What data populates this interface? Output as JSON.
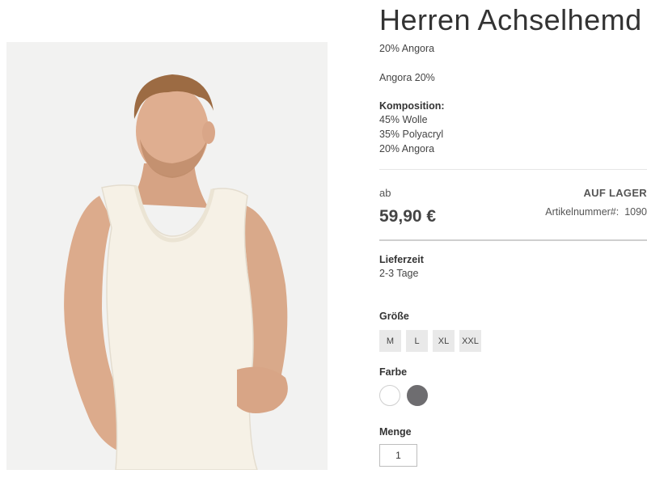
{
  "product": {
    "title": "Herren Achselhemd",
    "short_1": "20% Angora",
    "short_2": "Angora 20%",
    "composition_label": "Komposition:",
    "composition": [
      "45% Wolle",
      "35% Polyacryl",
      "20% Angora"
    ]
  },
  "pricing": {
    "prefix": "ab",
    "price": "59,90 €",
    "stock": "AUF LAGER",
    "article_label": "Artikelnummer#:",
    "article_number": "1090"
  },
  "delivery": {
    "label": "Lieferzeit",
    "value": "2-3 Tage"
  },
  "size": {
    "label": "Größe",
    "options": [
      "M",
      "L",
      "XL",
      "XXL"
    ]
  },
  "color": {
    "label": "Farbe",
    "options": [
      {
        "name": "white-swatch",
        "hex": "#ffffff"
      },
      {
        "name": "grey-swatch",
        "hex": "#6e6d70"
      }
    ]
  },
  "quantity": {
    "label": "Menge",
    "value": "1"
  }
}
